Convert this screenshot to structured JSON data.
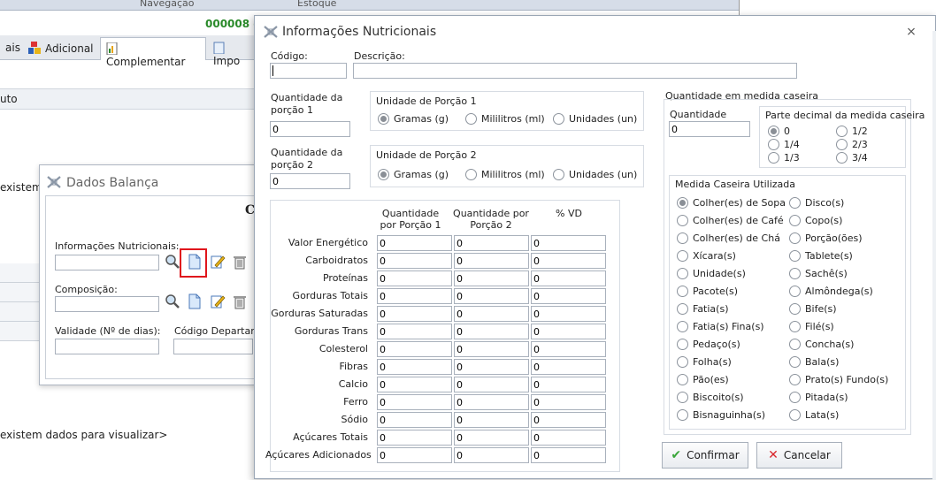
{
  "background": {
    "nav_labels": [
      "Navegação",
      "Estoque"
    ],
    "record_code": "000008 -",
    "tabs": [
      "ais",
      "Adicional",
      "Complementar",
      "Impo"
    ],
    "band_label": "uto",
    "empty_msg_1": "existem",
    "empty_msg_2": "existem dados para visualizar>"
  },
  "dados_balanca": {
    "title": "Dados Balança",
    "header_partial": "C",
    "info_nutricionais_label": "Informações Nutricionais:",
    "composicao_label": "Composição:",
    "validade_label": "Validade (Nº de dias):",
    "codigo_departamento_label": "Código Departamen"
  },
  "dialog": {
    "title": "Informações Nutricionais",
    "codigo_label": "Código:",
    "codigo_value": "",
    "descricao_label": "Descrição:",
    "descricao_value": "",
    "qtd_porcao1_label": "Quantidade da porção 1",
    "qtd_porcao1_value": "0",
    "qtd_porcao2_label": "Quantidade da porção 2",
    "qtd_porcao2_value": "0",
    "unidade1_title": "Unidade de Porção 1",
    "unidade2_title": "Unidade de Porção 2",
    "unidade_options": [
      "Gramas (g)",
      "Mililitros (ml)",
      "Unidades (un)"
    ],
    "unidade1_selected": 0,
    "unidade2_selected": 0,
    "table": {
      "headers": [
        "Quantidade por Porção 1",
        "Quantidade por Porção 2",
        "% VD"
      ],
      "rows": [
        {
          "label": "Valor Energético",
          "values": [
            "0",
            "0",
            "0"
          ]
        },
        {
          "label": "Carboidratos",
          "values": [
            "0",
            "0",
            "0"
          ]
        },
        {
          "label": "Proteínas",
          "values": [
            "0",
            "0",
            "0"
          ]
        },
        {
          "label": "Gorduras Totais",
          "values": [
            "0",
            "0",
            "0"
          ]
        },
        {
          "label": "Gorduras Saturadas",
          "values": [
            "0",
            "0",
            "0"
          ]
        },
        {
          "label": "Gorduras Trans",
          "values": [
            "0",
            "0",
            "0"
          ]
        },
        {
          "label": "Colesterol",
          "values": [
            "0",
            "0",
            "0"
          ]
        },
        {
          "label": "Fibras",
          "values": [
            "0",
            "0",
            "0"
          ]
        },
        {
          "label": "Calcio",
          "values": [
            "0",
            "0",
            "0"
          ]
        },
        {
          "label": "Ferro",
          "values": [
            "0",
            "0",
            "0"
          ]
        },
        {
          "label": "Sódio",
          "values": [
            "0",
            "0",
            "0"
          ]
        },
        {
          "label": "Açúcares Totais",
          "values": [
            "0",
            "0",
            "0"
          ]
        },
        {
          "label": "Açúcares Adicionados",
          "values": [
            "0",
            "0",
            "0"
          ]
        }
      ]
    },
    "medida_caseira": {
      "title": "Quantidade em medida caseira",
      "quantidade_label": "Quantidade",
      "quantidade_value": "0",
      "parte_decimal_title": "Parte decimal da medida caseira",
      "parte_decimal_options": [
        "0",
        "1/2",
        "1/4",
        "2/3",
        "1/3",
        "3/4"
      ],
      "parte_decimal_selected": 0,
      "utilizada_title": "Medida Caseira Utilizada",
      "utilizada_options": [
        "Colher(es) de Sopa",
        "Disco(s)",
        "Colher(es) de Café",
        "Copo(s)",
        "Colher(es) de Chá",
        "Porção(ões)",
        "Xícara(s)",
        "Tablete(s)",
        "Unidade(s)",
        "Sachê(s)",
        "Pacote(s)",
        "Almôndega(s)",
        "Fatia(s)",
        "Bife(s)",
        "Fatia(s) Fina(s)",
        "Filé(s)",
        "Pedaço(s)",
        "Concha(s)",
        "Folha(s)",
        "Bala(s)",
        "Pão(es)",
        "Prato(s) Fundo(s)",
        "Biscoito(s)",
        "Pitada(s)",
        "Bisnaguinha(s)",
        "Lata(s)"
      ],
      "utilizada_selected": 0
    },
    "confirmar_label": "Confirmar",
    "cancelar_label": "Cancelar",
    "colors": {
      "confirm_icon": "#3aa63a",
      "cancel_icon": "#d9262b",
      "highlight": "#e0161c"
    }
  }
}
